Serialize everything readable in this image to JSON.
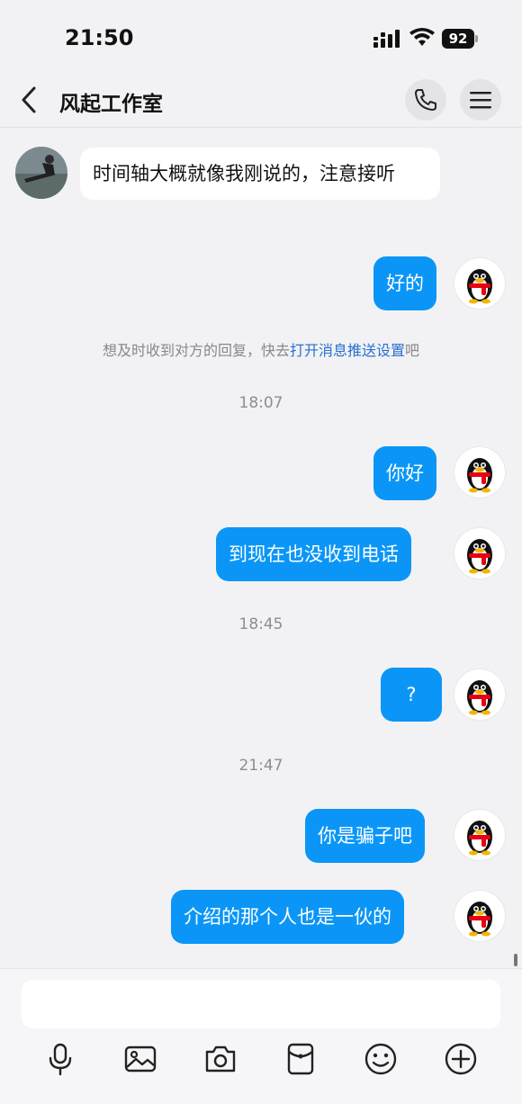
{
  "status_bar": {
    "time": "21:50",
    "battery": "92"
  },
  "header": {
    "title": "风起工作室"
  },
  "messages": [
    {
      "from": "other",
      "text": "时间轴大概就像我刚说的，注意接听"
    },
    {
      "from": "self",
      "text": "好的"
    }
  ],
  "system_note": {
    "prefix": "想及时收到对方的回复，快去",
    "link": "打开消息推送设置",
    "suffix": "吧"
  },
  "timestamps": [
    "18:07",
    "18:45",
    "21:47"
  ],
  "messages2": [
    {
      "from": "self",
      "text": "你好"
    },
    {
      "from": "self",
      "text": "到现在也没收到电话"
    },
    {
      "from": "self",
      "text": "?"
    },
    {
      "from": "self",
      "text": "你是骗子吧"
    },
    {
      "from": "self",
      "text": "介绍的那个人也是一伙的"
    }
  ],
  "input": {
    "placeholder": ""
  },
  "toolbar": [
    "microphone-icon",
    "image-icon",
    "camera-icon",
    "red-packet-icon",
    "emoji-icon",
    "plus-icon"
  ],
  "colors": {
    "accent": "#0b96f7",
    "background": "#f2f2f4",
    "link": "#2a6fd1"
  }
}
